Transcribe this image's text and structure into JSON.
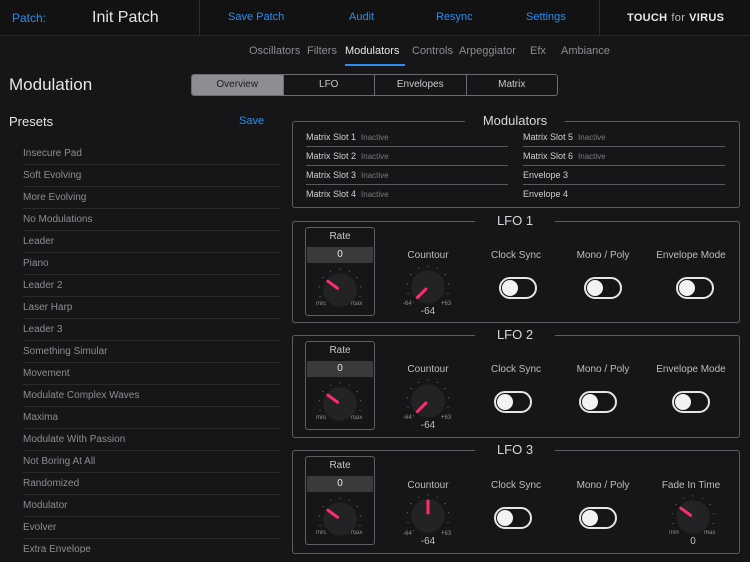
{
  "topbar": {
    "patch_label": "Patch:",
    "patch_name": "Init Patch",
    "save_patch": "Save Patch",
    "audit": "Audit",
    "resync": "Resync",
    "settings": "Settings",
    "brand_touch": "TOUCH",
    "brand_for": "for",
    "brand_virus": "VIRUS"
  },
  "nav": [
    "Oscillators",
    "Filters",
    "Modulators",
    "Controls",
    "Arpeggiator",
    "Efx",
    "Ambiance"
  ],
  "nav_active": "Modulators",
  "page_title": "Modulation",
  "segments": [
    "Overview",
    "LFO",
    "Envelopes",
    "Matrix"
  ],
  "segment_active": "Overview",
  "presets": {
    "title": "Presets",
    "save": "Save",
    "items": [
      "Insecure Pad",
      "Soft Evolving",
      "More Evolving",
      "No Modulations",
      "Leader",
      "Piano",
      "Leader 2",
      "Laser Harp",
      "Leader 3",
      "Something Simular",
      "Movement",
      "Modulate Complex Waves",
      "Maxima",
      "Modulate With Passion",
      "Not Boring At All",
      "Randomized",
      "Modulator",
      "Evolver",
      "Extra Envelope"
    ]
  },
  "modulators": {
    "title": "Modulators",
    "left_slots": [
      {
        "name": "Matrix Slot 1",
        "status": "Inactive"
      },
      {
        "name": "Matrix Slot 2",
        "status": "Inactive"
      },
      {
        "name": "Matrix Slot 3",
        "status": "Inactive"
      },
      {
        "name": "Matrix Slot 4",
        "status": "Inactive"
      }
    ],
    "right_slots": [
      {
        "name": "Matrix Slot 5",
        "status": "Inactive"
      },
      {
        "name": "Matrix Slot 6",
        "status": "Inactive"
      },
      {
        "name": "Envelope 3",
        "status": ""
      },
      {
        "name": "Envelope 4",
        "status": ""
      }
    ]
  },
  "lfos": [
    {
      "title": "LFO 1",
      "rate": {
        "label": "Rate",
        "value": "0",
        "min": "min",
        "max": "max",
        "knob_position": 0.3
      },
      "contour": {
        "label": "Countour",
        "value": "-64",
        "min": "-64",
        "max": "+63",
        "knob_position": 0.0
      },
      "toggles": [
        {
          "label": "Clock Sync",
          "on": false
        },
        {
          "label": "Mono / Poly",
          "on": false
        },
        {
          "label": "Envelope Mode",
          "on": false
        }
      ]
    },
    {
      "title": "LFO 2",
      "rate": {
        "label": "Rate",
        "value": "0",
        "min": "min",
        "max": "max",
        "knob_position": 0.3
      },
      "contour": {
        "label": "Countour",
        "value": "-64",
        "min": "-64",
        "max": "+63",
        "knob_position": 0.0
      },
      "toggles": [
        {
          "label": "Clock Sync",
          "on": false
        },
        {
          "label": "Mono / Poly",
          "on": false
        },
        {
          "label": "Envelope Mode",
          "on": false
        }
      ]
    },
    {
      "title": "LFO 3",
      "rate": {
        "label": "Rate",
        "value": "0",
        "min": "min",
        "max": "max",
        "knob_position": 0.3
      },
      "contour": {
        "label": "Countour",
        "value": "-64",
        "min": "-64",
        "max": "+63",
        "knob_position": 0.5
      },
      "toggles": [
        {
          "label": "Clock Sync",
          "on": false
        },
        {
          "label": "Mono / Poly",
          "on": false
        }
      ],
      "fade_in": {
        "label": "Fade In Time",
        "value": "0",
        "min": "min",
        "max": "max",
        "knob_position": 0.3
      }
    }
  ],
  "colors": {
    "accent_blue": "#2b8cf0",
    "knob_pointer": "#ff2d6a",
    "background": "#161618"
  }
}
